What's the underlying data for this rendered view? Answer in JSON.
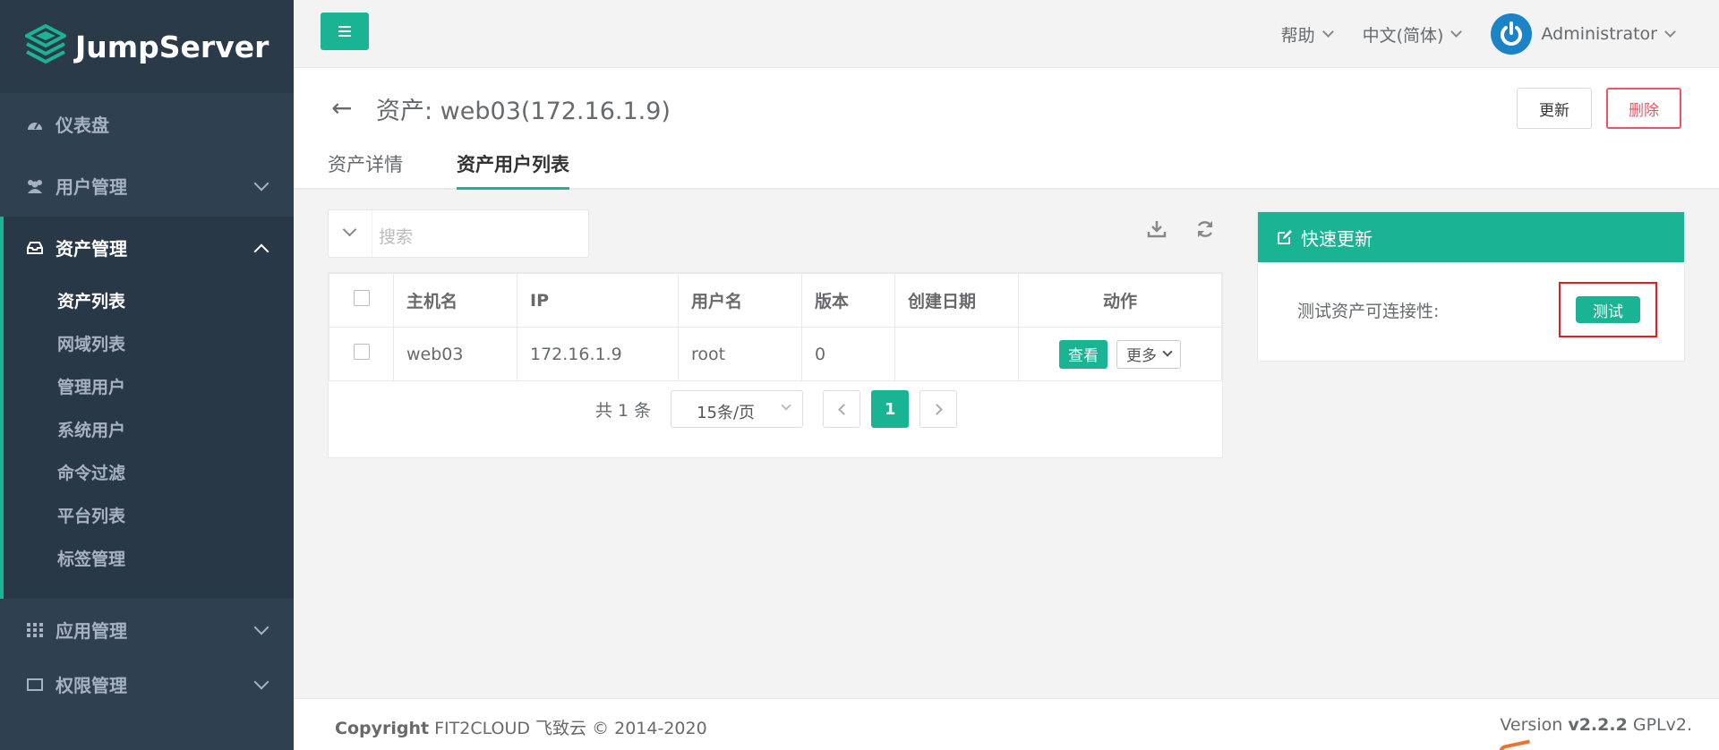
{
  "brand": {
    "name": "JumpServer"
  },
  "sidebar": {
    "items": [
      {
        "label": "仪表盘",
        "icon": "dashboard-icon"
      },
      {
        "label": "用户管理",
        "icon": "users-icon"
      },
      {
        "label": "资产管理",
        "icon": "inbox-icon"
      },
      {
        "label": "应用管理",
        "icon": "grid-icon"
      },
      {
        "label": "权限管理",
        "icon": "permission-icon"
      }
    ],
    "asset_sub": [
      "资产列表",
      "网域列表",
      "管理用户",
      "系统用户",
      "命令过滤",
      "平台列表",
      "标签管理"
    ]
  },
  "topbar": {
    "help": "帮助",
    "language": "中文(简体)",
    "user": "Administrator"
  },
  "page": {
    "back_icon": "←",
    "title": "资产: web03(172.16.1.9)",
    "update_label": "更新",
    "delete_label": "删除",
    "tabs": [
      "资产详情",
      "资产用户列表"
    ]
  },
  "search": {
    "placeholder": "搜索"
  },
  "table": {
    "columns": [
      "主机名",
      "IP",
      "用户名",
      "版本",
      "创建日期",
      "动作"
    ],
    "rows": [
      {
        "hostname": "web03",
        "ip": "172.16.1.9",
        "username": "root",
        "version": "0",
        "created": "",
        "view": "查看",
        "more": "更多"
      }
    ]
  },
  "pagination": {
    "total": "共 1 条",
    "page_size": "15条/页",
    "current_page": "1"
  },
  "quick_update": {
    "title": "快速更新",
    "label": "测试资产可连接性:",
    "test_button": "测试"
  },
  "footer": {
    "copyright_bold": "Copyright",
    "copyright_rest": " FIT2CLOUD 飞致云 © 2014-2020",
    "version_prefix": "Version ",
    "version_num": "v2.2.2",
    "version_suffix": " GPLv2."
  },
  "colors": {
    "accent": "#1ab394",
    "sidebar": "#2f4050",
    "danger": "#ed5565",
    "highlight": "#e02020"
  }
}
